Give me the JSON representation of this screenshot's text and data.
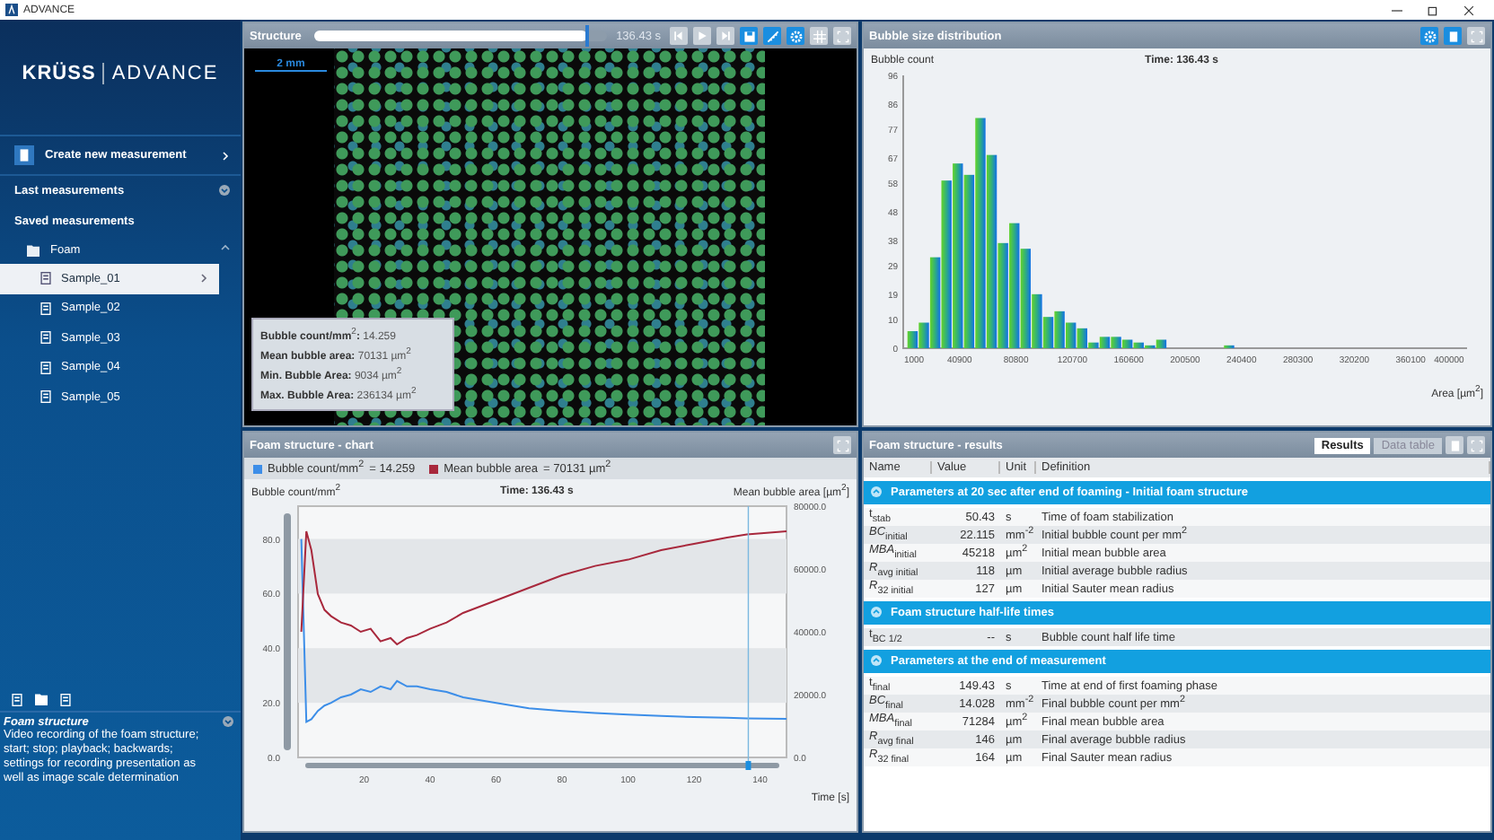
{
  "window": {
    "title": "ADVANCE"
  },
  "sidebar": {
    "logo_brand": "KRÜSS",
    "logo_product": "ADVANCE",
    "create_button": "Create new measurement",
    "last_measurements": {
      "label": "Last measurements",
      "expanded": false
    },
    "saved_measurements": "Saved measurements",
    "folders": [
      {
        "label": "Foam",
        "expanded": true,
        "children": [
          {
            "label": "Sample_01",
            "selected": true
          },
          {
            "label": "Sample_02",
            "selected": false
          },
          {
            "label": "Sample_03",
            "selected": false
          },
          {
            "label": "Sample_04",
            "selected": false
          },
          {
            "label": "Sample_05",
            "selected": false
          }
        ]
      }
    ],
    "help": {
      "title": "Foam structure",
      "text": "Video recording of the foam structure; start; stop; playback; backwards; settings for recording presentation as well as image scale determination"
    }
  },
  "structure": {
    "title": "Structure",
    "position": "136.43 s",
    "level": 0.93,
    "scale": "2 mm",
    "stats": [
      "**Bubble count/mm**$^{2}$**:** 14.259",
      "**Mean bubble area:** 70131 µm$^{2}$",
      "**Min. Bubble Area:** 9034 µm$^{2}$",
      "**Max. Bubble Area:** 236134 µm$^{2}$"
    ]
  },
  "distribution": {
    "title": "Bubble size distribution",
    "time": "Time: 136.43 s",
    "ylabel": "Bubble count",
    "xlabel": "Area [µm$^{2}$]",
    "chart_data": {
      "type": "bar",
      "xlim": [
        1000,
        400000
      ],
      "ylim": [
        0,
        96
      ],
      "x": [
        8000,
        16000,
        24000,
        32000,
        40000,
        48000,
        56000,
        64000,
        72000,
        80000,
        88000,
        96000,
        104000,
        112000,
        120000,
        128000,
        136000,
        144000,
        152000,
        160000,
        168000,
        176000,
        184000,
        192000,
        200000,
        208000,
        216000,
        224000,
        232000
      ],
      "values": [
        6,
        9,
        32,
        59,
        65,
        61,
        81,
        68,
        37,
        44,
        35,
        19,
        11,
        13,
        9,
        7,
        2,
        4,
        4,
        3,
        2,
        1,
        3,
        0,
        0,
        0,
        0,
        0,
        1
      ],
      "xticks": [
        1000,
        40900,
        80800,
        120700,
        160600,
        200500,
        240400,
        280300,
        320200,
        360100,
        400000
      ],
      "yticks": [
        0,
        10,
        19,
        29,
        38,
        48,
        58,
        67,
        77,
        86,
        96
      ]
    }
  },
  "foam_chart": {
    "title": "Foam structure - chart",
    "legend_values": [
      "= 14.259",
      "= 70131 µm$^{2}$"
    ],
    "ylabel": "Bubble count/mm$^{2}$",
    "y2label": "Mean bubble area [µm$^{2}$]",
    "time": "Time: 136.43 s",
    "xlabel": "Time [s]",
    "chart_data": {
      "type": "line",
      "xlim": [
        0,
        148
      ],
      "ylim": [
        0,
        92
      ],
      "y2lim": [
        0,
        80000
      ],
      "x": [
        1,
        2.5,
        4,
        6,
        8,
        10,
        13,
        16,
        19,
        22,
        25,
        28,
        30,
        33,
        36,
        40,
        45,
        50,
        60,
        70,
        80,
        90,
        100,
        110,
        120,
        130,
        136,
        142,
        148
      ],
      "series": [
        {
          "name": "Bubble count/mm$^{2}$",
          "color": "#3d8ee8",
          "values": [
            80,
            13,
            14,
            17,
            19,
            20,
            22,
            23,
            25,
            24,
            26,
            25,
            28,
            26,
            26,
            25,
            24,
            22,
            20,
            18,
            17,
            16.3,
            15.7,
            15.2,
            14.8,
            14.5,
            14.3,
            14.2,
            14.1
          ]
        },
        {
          "name": "Mean bubble area",
          "color": "#a8283c",
          "axis": "y2",
          "values": [
            40000,
            72000,
            66000,
            52000,
            47000,
            45000,
            43000,
            42000,
            40000,
            41000,
            37000,
            38000,
            36000,
            38000,
            39000,
            41000,
            43000,
            46000,
            50000,
            54000,
            58000,
            61000,
            63000,
            66000,
            68000,
            70000,
            71000,
            71500,
            72000
          ]
        }
      ],
      "xticks": [
        20,
        40,
        60,
        80,
        100,
        120,
        140
      ],
      "yticks": [
        {
          "value": 0,
          "label": "0.0"
        },
        {
          "value": 20,
          "label": "20.0"
        },
        {
          "value": 40,
          "label": "40.0"
        },
        {
          "value": 60,
          "label": "60.0"
        },
        {
          "value": 80,
          "label": "80.0"
        }
      ],
      "y2ticks": [
        {
          "value": 0,
          "label": "0.0"
        },
        {
          "value": 20000,
          "label": "20000.0"
        },
        {
          "value": 40000,
          "label": "40000.0"
        },
        {
          "value": 60000,
          "label": "60000.0"
        },
        {
          "value": 80000,
          "label": "80000.0"
        }
      ],
      "ref_lines": [
        {
          "value": 136.43,
          "axis": "x",
          "color": "#7bb8e0"
        }
      ]
    }
  },
  "results": {
    "title": "Foam structure - results",
    "tabs": [
      {
        "label": "Results",
        "selected": true
      },
      {
        "label": "Data table",
        "selected": false
      }
    ],
    "columns": [
      "Name",
      "Value",
      "Unit",
      "Definition"
    ],
    "sections": [
      {
        "title": "Parameters at 20 sec after end of foaming - Initial foam structure",
        "expanded": true,
        "rows": [
          {
            "name": "t$_{stab}$",
            "value": "50.43",
            "unit": "s",
            "definition": "Time of foam stabilization"
          },
          {
            "name": "*BC*$_{initial}$",
            "value": "22.115",
            "unit": "mm$^{-2}$",
            "definition": "Initial bubble count per mm$^{2}$"
          },
          {
            "name": "*MBA*$_{initial}$",
            "value": "45218",
            "unit": "µm$^{2}$",
            "definition": "Initial mean bubble area"
          },
          {
            "name": "*R*$_{avg initial}$",
            "value": "118",
            "unit": "µm",
            "definition": "Initial average bubble radius"
          },
          {
            "name": "*R*$_{32 initial}$",
            "value": "127",
            "unit": "µm",
            "definition": "Initial Sauter mean radius"
          }
        ]
      },
      {
        "title": "Foam structure half-life times",
        "expanded": true,
        "rows": [
          {
            "name": "t$_{BC 1/2}$",
            "value": "--",
            "unit": "s",
            "definition": "Bubble count half life time"
          }
        ]
      },
      {
        "title": "Parameters at the end of measurement",
        "expanded": true,
        "rows": [
          {
            "name": "t$_{final}$",
            "value": "149.43",
            "unit": "s",
            "definition": "Time at end of first foaming phase"
          },
          {
            "name": "*BC*$_{final}$",
            "value": "14.028",
            "unit": "mm$^{-2}$",
            "definition": "Final bubble count per mm$^{2}$"
          },
          {
            "name": "*MBA*$_{final}$",
            "value": "71284",
            "unit": "µm$^{2}$",
            "definition": "Final mean bubble area"
          },
          {
            "name": "*R*$_{avg final}$",
            "value": "146",
            "unit": "µm",
            "definition": "Final average bubble radius"
          },
          {
            "name": "*R*$_{32 final}$",
            "value": "164",
            "unit": "µm",
            "definition": "Final Sauter mean radius"
          }
        ]
      }
    ]
  }
}
